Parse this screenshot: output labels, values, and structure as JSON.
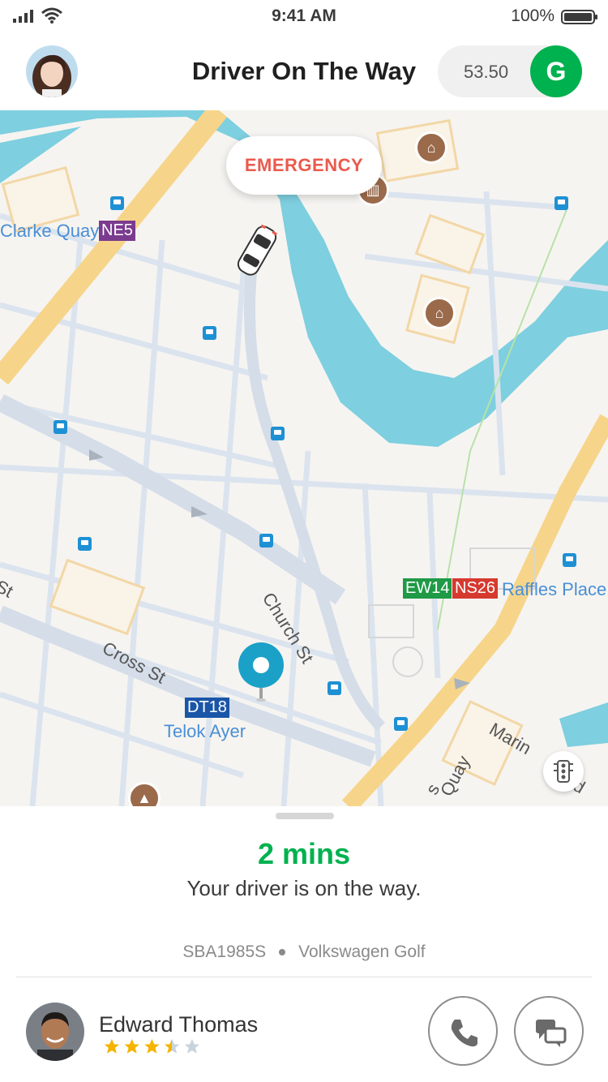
{
  "status_bar": {
    "time": "9:41 AM",
    "battery": "100%"
  },
  "header": {
    "title": "Driver On The Way",
    "balance": "53.50",
    "brand_letter": "G"
  },
  "map": {
    "emergency_label": "EMERGENCY",
    "places": {
      "clarke_quay": "Clarke Quay",
      "clarke_quay_code": "NE5",
      "raffles_place": "Raffles Place",
      "raffles_code_ew": "EW14",
      "raffles_code_ns": "NS26",
      "telok_ayer": "Telok Ayer",
      "telok_ayer_code": "DT18"
    },
    "streets": {
      "church_st": "Church St",
      "cross_st": "Cross St",
      "st_fragment": "St",
      "quay_fragment": "Quay",
      "s_fragment": "s",
      "marina_fragment": "Marin",
      "vd_fragment": "vd"
    }
  },
  "trip": {
    "eta": "2 mins",
    "eta_message": "Your driver is on the way.",
    "plate": "SBA1985S",
    "vehicle": "Volkswagen Golf"
  },
  "driver": {
    "name": "Edward Thomas",
    "rating": 3.5,
    "rating_max": 5
  },
  "colors": {
    "brand_green": "#00b14f",
    "emergency_red": "#ea5a4d",
    "water": "#7ecfdf",
    "major_road": "#f6d58a",
    "star": "#f4b400"
  }
}
